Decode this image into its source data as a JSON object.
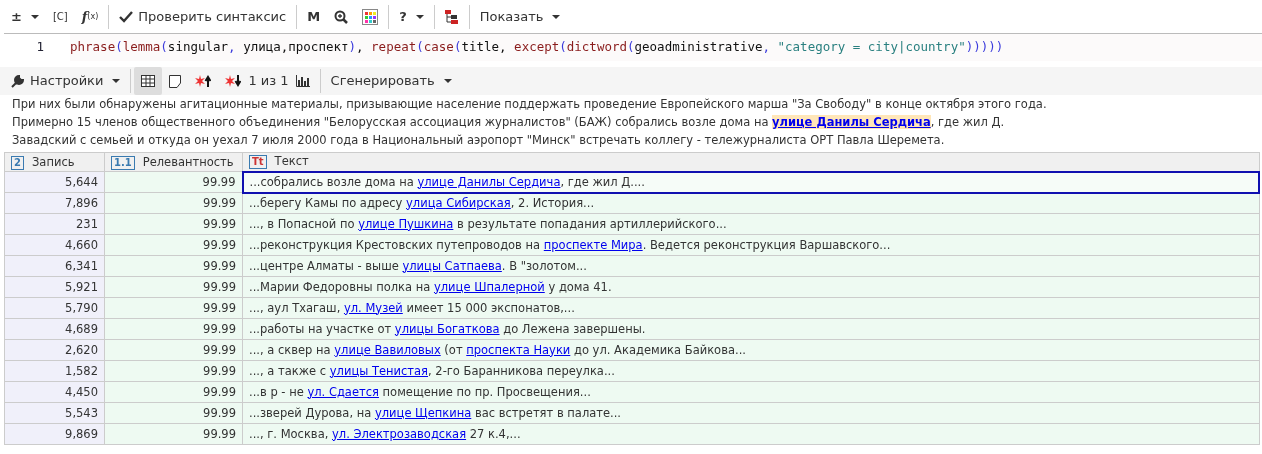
{
  "top_toolbar": {
    "buttons": [
      {
        "kind": "plusminus",
        "label": "±",
        "caret": true
      },
      {
        "kind": "bracket",
        "label": "[C]"
      },
      {
        "kind": "fx",
        "label": "f",
        "sub": "(x)"
      },
      {
        "kind": "check",
        "label": "Проверить синтаксис"
      },
      {
        "kind": "letter",
        "label": "M"
      },
      {
        "kind": "zoom"
      },
      {
        "kind": "palette"
      },
      {
        "kind": "letter",
        "label": "?",
        "caret": true
      },
      {
        "kind": "tree"
      },
      {
        "kind": "text",
        "label": "Показать",
        "caret": true
      }
    ]
  },
  "editor": {
    "line_number": "1",
    "code": [
      {
        "kind": "func",
        "text": "phrase"
      },
      {
        "kind": "paren",
        "text": "("
      },
      {
        "kind": "func",
        "text": "lemma"
      },
      {
        "kind": "paren",
        "text": "("
      },
      {
        "kind": "plain",
        "text": "singular"
      },
      {
        "kind": "paren",
        "text": ","
      },
      {
        "kind": "plain",
        "text": " улица,проспект"
      },
      {
        "kind": "paren",
        "text": ")"
      },
      {
        "kind": "plain",
        "text": ", "
      },
      {
        "kind": "func",
        "text": "repeat"
      },
      {
        "kind": "paren",
        "text": "("
      },
      {
        "kind": "func",
        "text": "case"
      },
      {
        "kind": "paren",
        "text": "("
      },
      {
        "kind": "plain",
        "text": "title, "
      },
      {
        "kind": "func",
        "text": "except"
      },
      {
        "kind": "paren",
        "text": "("
      },
      {
        "kind": "func",
        "text": "dictword"
      },
      {
        "kind": "paren",
        "text": "("
      },
      {
        "kind": "plain",
        "text": "geoadministrative"
      },
      {
        "kind": "paren",
        "text": ","
      },
      {
        "kind": "string",
        "text": " \"category = city|country\""
      },
      {
        "kind": "paren",
        "text": ")))))"
      }
    ]
  },
  "results_toolbar": {
    "settings": "Настройки",
    "table_view_selected": true,
    "page_info": "1 из 1",
    "generate": "Сгенерировать"
  },
  "preview": {
    "lines": [
      [
        {
          "text": "При них были обнаружены агитационные материалы, призывающие население поддержать проведение Европейского марша \"За Свободу\" в конце октября этого года.",
          "link": false
        }
      ],
      [
        {
          "text": "Примерно 15 членов общественного объединения \"Белорусская ассоциация журналистов\" (БАЖ) собрались возле дома на ",
          "link": false
        },
        {
          "text": "улице Данилы Сердича",
          "link": true
        },
        {
          "text": ", где жил Д.",
          "link": false
        }
      ],
      [
        {
          "text": "Завадский с семьей и откуда он уехал 7 июля 2000 года в Национальный аэропорт \"Минск\" встречать коллегу - тележурналиста ОРТ Павла Шеремета.",
          "link": false
        }
      ]
    ]
  },
  "table": {
    "columns": [
      {
        "kind": "number",
        "type_icon": "2",
        "label": "Запись"
      },
      {
        "kind": "decimal",
        "type_icon": "1.1",
        "label": "Релевантность"
      },
      {
        "kind": "text",
        "type_icon": "Tt",
        "label": "Текст"
      }
    ],
    "rows": [
      {
        "record": "5,644",
        "relevance": "99.99",
        "selected": true,
        "text": [
          {
            "text": "...собрались возле дома на ",
            "link": false
          },
          {
            "text": "улице Данилы Сердича",
            "link": true
          },
          {
            "text": ", где жил Д....",
            "link": false
          }
        ]
      },
      {
        "record": "7,896",
        "relevance": "99.99",
        "selected": false,
        "text": [
          {
            "text": "...берегу Камы по адресу ",
            "link": false
          },
          {
            "text": "улица Сибирская",
            "link": true
          },
          {
            "text": ", 2. История...",
            "link": false
          }
        ]
      },
      {
        "record": "231",
        "relevance": "99.99",
        "selected": false,
        "text": [
          {
            "text": "..., в Попасной по ",
            "link": false
          },
          {
            "text": "улице Пушкина",
            "link": true
          },
          {
            "text": " в результате попадания артиллерийского...",
            "link": false
          }
        ]
      },
      {
        "record": "4,660",
        "relevance": "99.99",
        "selected": false,
        "text": [
          {
            "text": "...реконструкция Крестовских путепроводов на ",
            "link": false
          },
          {
            "text": "проспекте Мира",
            "link": true
          },
          {
            "text": ". Ведется реконструкция Варшавского...",
            "link": false
          }
        ]
      },
      {
        "record": "6,341",
        "relevance": "99.99",
        "selected": false,
        "text": [
          {
            "text": "...центре Алматы - выше ",
            "link": false
          },
          {
            "text": "улицы Сатпаева",
            "link": true
          },
          {
            "text": ". В \"золотом...",
            "link": false
          }
        ]
      },
      {
        "record": "5,921",
        "relevance": "99.99",
        "selected": false,
        "text": [
          {
            "text": "...Марии Федоровны полка на ",
            "link": false
          },
          {
            "text": "улице Шпалерной",
            "link": true
          },
          {
            "text": " у дома 41.",
            "link": false
          }
        ]
      },
      {
        "record": "5,790",
        "relevance": "99.99",
        "selected": false,
        "text": [
          {
            "text": "..., аул Тхагаш, ",
            "link": false
          },
          {
            "text": "ул. Музей",
            "link": true
          },
          {
            "text": " имеет 15 000 экспонатов,...",
            "link": false
          }
        ]
      },
      {
        "record": "4,689",
        "relevance": "99.99",
        "selected": false,
        "text": [
          {
            "text": "...работы на участке от ",
            "link": false
          },
          {
            "text": "улицы Богаткова",
            "link": true
          },
          {
            "text": " до Лежена завершены.",
            "link": false
          }
        ]
      },
      {
        "record": "2,620",
        "relevance": "99.99",
        "selected": false,
        "text": [
          {
            "text": "..., а сквер на ",
            "link": false
          },
          {
            "text": "улице Вавиловых",
            "link": true
          },
          {
            "text": " (от ",
            "link": false
          },
          {
            "text": "проспекта Науки",
            "link": true
          },
          {
            "text": " до ул. Академика Байкова...",
            "link": false
          }
        ]
      },
      {
        "record": "1,582",
        "relevance": "99.99",
        "selected": false,
        "text": [
          {
            "text": "..., а также с ",
            "link": false
          },
          {
            "text": "улицы Тенистая",
            "link": true
          },
          {
            "text": ", 2-го Баранникова переулка...",
            "link": false
          }
        ]
      },
      {
        "record": "4,450",
        "relevance": "99.99",
        "selected": false,
        "text": [
          {
            "text": "...в р - не ",
            "link": false
          },
          {
            "text": "ул. Сдается",
            "link": true
          },
          {
            "text": " помещение по пр. Просвещения...",
            "link": false
          }
        ]
      },
      {
        "record": "5,543",
        "relevance": "99.99",
        "selected": false,
        "text": [
          {
            "text": "...зверей Дурова, на ",
            "link": false
          },
          {
            "text": "улице Щепкина",
            "link": true
          },
          {
            "text": " вас встретят в палате...",
            "link": false
          }
        ]
      },
      {
        "record": "9,869",
        "relevance": "99.99",
        "selected": false,
        "text": [
          {
            "text": "..., г. Москва, ",
            "link": false
          },
          {
            "text": "ул. Электрозаводская",
            "link": true
          },
          {
            "text": " 27 к.4,...",
            "link": false
          }
        ]
      }
    ]
  }
}
